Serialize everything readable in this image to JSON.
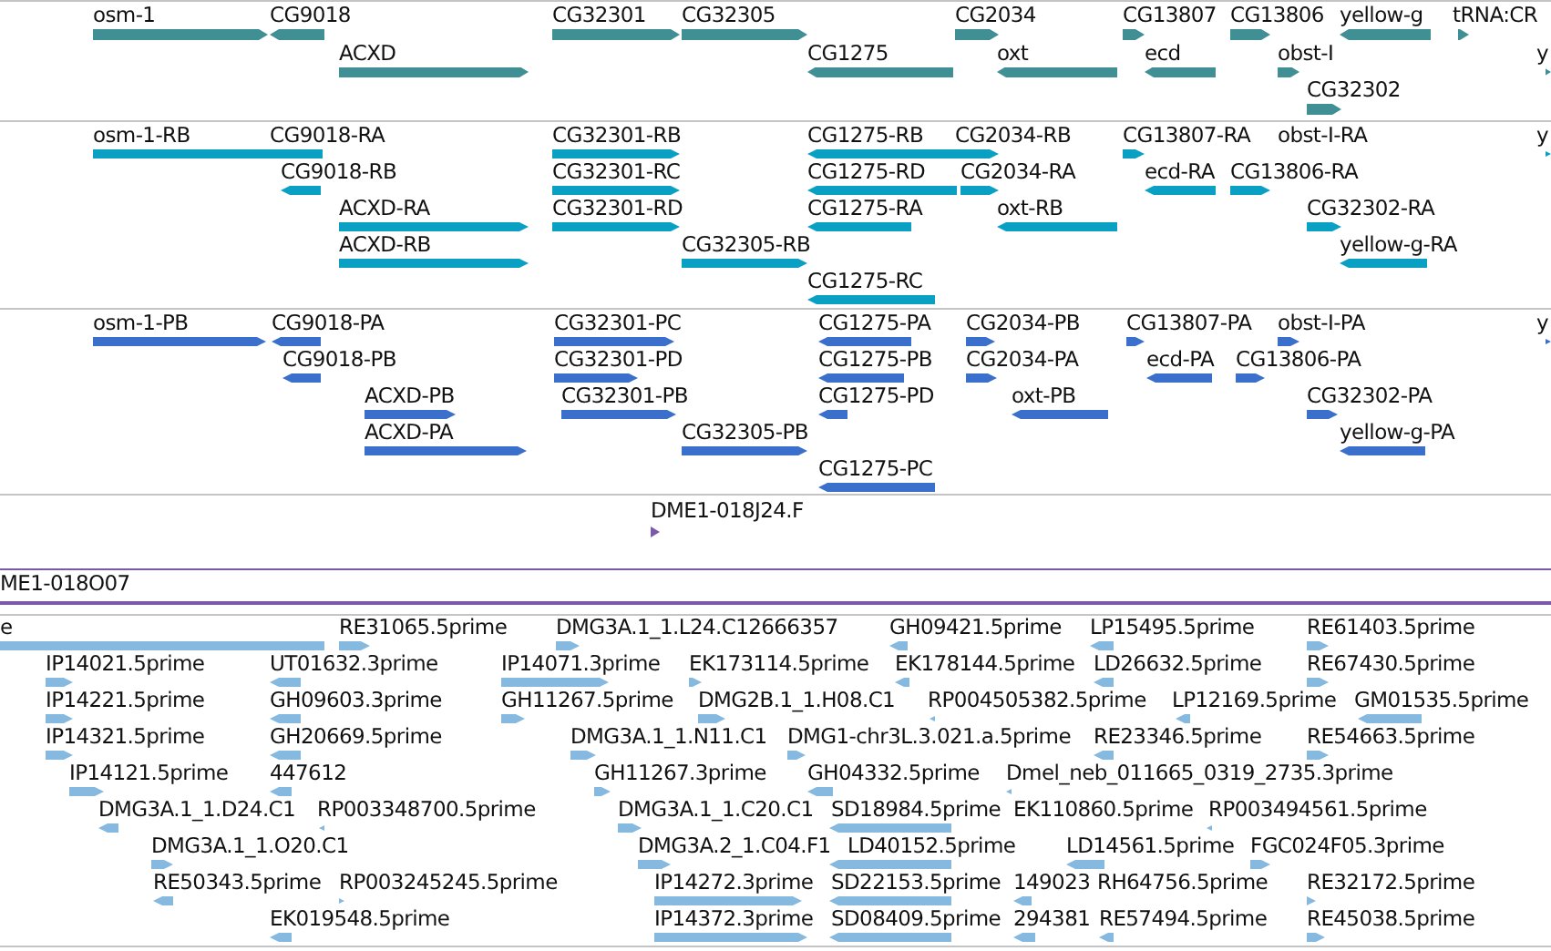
{
  "tracks": [
    {
      "kind": "gene",
      "features": [
        {
          "label": "osm-1",
          "kind": "forward"
        },
        {
          "label": "CG9018",
          "kind": "reverse"
        },
        {
          "label": "CG32301",
          "kind": "forward"
        },
        {
          "label": "CG32305",
          "kind": "forward"
        },
        {
          "label": "CG2034",
          "kind": "forward"
        },
        {
          "label": "CG13807",
          "kind": "forward"
        },
        {
          "label": "CG13806",
          "kind": "forward"
        },
        {
          "label": "yellow-g",
          "kind": "reverse"
        },
        {
          "label": "tRNA:CR",
          "kind": "forward"
        },
        {
          "label": "ACXD",
          "kind": "forward"
        },
        {
          "label": "CG1275",
          "kind": "reverse"
        },
        {
          "label": "oxt",
          "kind": "reverse"
        },
        {
          "label": "ecd",
          "kind": "reverse"
        },
        {
          "label": "obst-I",
          "kind": "forward"
        },
        {
          "label": "y",
          "kind": "forward"
        },
        {
          "label": "CG32302",
          "kind": "forward"
        }
      ]
    },
    {
      "kind": "transcript",
      "features": [
        {
          "label": "osm-1-RB",
          "kind": "forward"
        },
        {
          "label": "CG9018-RA",
          "kind": "reverse"
        },
        {
          "label": "CG32301-RB",
          "kind": "forward"
        },
        {
          "label": "CG1275-RB",
          "kind": "reverse"
        },
        {
          "label": "CG2034-RB",
          "kind": "forward"
        },
        {
          "label": "CG13807-RA",
          "kind": "forward"
        },
        {
          "label": "obst-I-RA"
        },
        {
          "label": "y",
          "kind": "forward"
        },
        {
          "label": "CG9018-RB",
          "kind": "reverse"
        },
        {
          "label": "CG32301-RC",
          "kind": "forward"
        },
        {
          "label": "CG1275-RD",
          "kind": "reverse"
        },
        {
          "label": "CG2034-RA",
          "kind": "forward"
        },
        {
          "label": "ecd-RA",
          "kind": "reverse"
        },
        {
          "label": "CG13806-RA",
          "kind": "forward"
        },
        {
          "label": "ACXD-RA",
          "kind": "forward"
        },
        {
          "label": "CG32301-RD",
          "kind": "forward"
        },
        {
          "label": "CG1275-RA",
          "kind": "reverse"
        },
        {
          "label": "oxt-RB",
          "kind": "reverse"
        },
        {
          "label": "CG32302-RA",
          "kind": "forward"
        },
        {
          "label": "ACXD-RB",
          "kind": "forward"
        },
        {
          "label": "CG32305-RB",
          "kind": "forward"
        },
        {
          "label": "yellow-g-RA",
          "kind": "reverse"
        },
        {
          "label": "CG1275-RC",
          "kind": "reverse"
        }
      ]
    },
    {
      "kind": "protein",
      "features": [
        {
          "label": "osm-1-PB",
          "kind": "forward"
        },
        {
          "label": "CG9018-PA",
          "kind": "reverse"
        },
        {
          "label": "CG32301-PC",
          "kind": "forward"
        },
        {
          "label": "CG1275-PA",
          "kind": "reverse"
        },
        {
          "label": "CG2034-PB",
          "kind": "forward"
        },
        {
          "label": "CG13807-PA",
          "kind": "forward"
        },
        {
          "label": "obst-I-PA",
          "kind": "forward"
        },
        {
          "label": "y",
          "kind": "forward"
        },
        {
          "label": "CG9018-PB",
          "kind": "reverse"
        },
        {
          "label": "CG32301-PD",
          "kind": "forward"
        },
        {
          "label": "CG1275-PB",
          "kind": "reverse"
        },
        {
          "label": "CG2034-PA",
          "kind": "forward"
        },
        {
          "label": "ecd-PA",
          "kind": "reverse"
        },
        {
          "label": "CG13806-PA",
          "kind": "forward"
        },
        {
          "label": "ACXD-PB",
          "kind": "forward"
        },
        {
          "label": "CG32301-PB",
          "kind": "forward"
        },
        {
          "label": "CG1275-PD",
          "kind": "reverse"
        },
        {
          "label": "oxt-PB",
          "kind": "reverse"
        },
        {
          "label": "CG32302-PA",
          "kind": "forward"
        },
        {
          "label": "ACXD-PA",
          "kind": "forward"
        },
        {
          "label": "CG32305-PB",
          "kind": "forward"
        },
        {
          "label": "yellow-g-PA",
          "kind": "reverse"
        },
        {
          "label": "CG1275-PC",
          "kind": "reverse"
        }
      ]
    },
    {
      "kind": "clone",
      "features": [
        {
          "label": "DME1-018J24.F",
          "kind": "forward"
        }
      ]
    },
    {
      "kind": "clone",
      "features": [
        {
          "label": "ME1-018O07",
          "kind": "plain"
        }
      ]
    },
    {
      "kind": "est",
      "features": [
        {
          "label": "e",
          "kind": "plain"
        },
        {
          "label": "RE31065.5prime",
          "kind": "forward"
        },
        {
          "label": "DMG3A.1_1.L24.C12666357",
          "kind": "forward"
        },
        {
          "label": "GH09421.5prime",
          "kind": "reverse"
        },
        {
          "label": "LP15495.5prime",
          "kind": "reverse"
        },
        {
          "label": "RE61403.5prime",
          "kind": "forward"
        },
        {
          "label": "IP14021.5prime",
          "kind": "forward"
        },
        {
          "label": "UT01632.3prime",
          "kind": "reverse"
        },
        {
          "label": "IP14071.3prime",
          "kind": "forward"
        },
        {
          "label": "EK173114.5prime",
          "kind": "forward"
        },
        {
          "label": "EK178144.5prime",
          "kind": "reverse"
        },
        {
          "label": "LD26632.5prime",
          "kind": "reverse"
        },
        {
          "label": "RE67430.5prime",
          "kind": "forward"
        },
        {
          "label": "IP14221.5prime",
          "kind": "forward"
        },
        {
          "label": "GH09603.3prime",
          "kind": "reverse"
        },
        {
          "label": "GH11267.5prime",
          "kind": "forward"
        },
        {
          "label": "DMG2B.1_1.H08.C1",
          "kind": "forward"
        },
        {
          "label": "RP004505382.5prime",
          "kind": "reverse"
        },
        {
          "label": "LP12169.5prime",
          "kind": "reverse"
        },
        {
          "label": "GM01535.5prime",
          "kind": "reverse"
        },
        {
          "label": "IP14321.5prime",
          "kind": "forward"
        },
        {
          "label": "GH20669.5prime",
          "kind": "reverse"
        },
        {
          "label": "DMG3A.1_1.N11.C1",
          "kind": "forward"
        },
        {
          "label": "DMG1-chr3L.3.021.a.5prime",
          "kind": "forward"
        },
        {
          "label": "RE23346.5prime",
          "kind": "reverse"
        },
        {
          "label": "RE54663.5prime",
          "kind": "forward"
        },
        {
          "label": "IP14121.5prime",
          "kind": "forward"
        },
        {
          "label": "447612",
          "kind": "reverse"
        },
        {
          "label": "GH11267.3prime",
          "kind": "forward"
        },
        {
          "label": "GH04332.5prime",
          "kind": "reverse"
        },
        {
          "label": "Dmel_neb_011665_0319_2735.3prime",
          "kind": "reverse"
        },
        {
          "label": "DMG3A.1_1.D24.C1",
          "kind": "reverse"
        },
        {
          "label": "RP003348700.5prime",
          "kind": "reverse"
        },
        {
          "label": "DMG3A.1_1.C20.C1",
          "kind": "forward"
        },
        {
          "label": "SD18984.5prime",
          "kind": "reverse"
        },
        {
          "label": "EK110860.5prime"
        },
        {
          "label": "RP003494561.5prime",
          "kind": "reverse"
        },
        {
          "label": "DMG3A.1_1.O20.C1",
          "kind": "forward"
        },
        {
          "label": "DMG3A.2_1.C04.F1",
          "kind": "forward"
        },
        {
          "label": "LD40152.5prime",
          "kind": "reverse"
        },
        {
          "label": "LD14561.5prime",
          "kind": "reverse"
        },
        {
          "label": "FGC024F05.3prime",
          "kind": "forward"
        },
        {
          "label": "RE50343.5prime",
          "kind": "reverse"
        },
        {
          "label": "RP003245245.5prime",
          "kind": "forward"
        },
        {
          "label": "IP14272.3prime",
          "kind": "forward"
        },
        {
          "label": "SD22153.5prime",
          "kind": "reverse"
        },
        {
          "label": "149023",
          "kind": "reverse"
        },
        {
          "label": "RH64756.5prime"
        },
        {
          "label": "RE32172.5prime",
          "kind": "forward"
        },
        {
          "label": "EK019548.5prime",
          "kind": "reverse"
        },
        {
          "label": "IP14372.3prime",
          "kind": "forward"
        },
        {
          "label": "SD08409.5prime",
          "kind": "reverse"
        },
        {
          "label": "294381",
          "kind": "reverse"
        },
        {
          "label": "RE57494.5prime",
          "kind": "reverse"
        },
        {
          "label": "RE45038.5prime",
          "kind": "forward"
        }
      ]
    }
  ]
}
